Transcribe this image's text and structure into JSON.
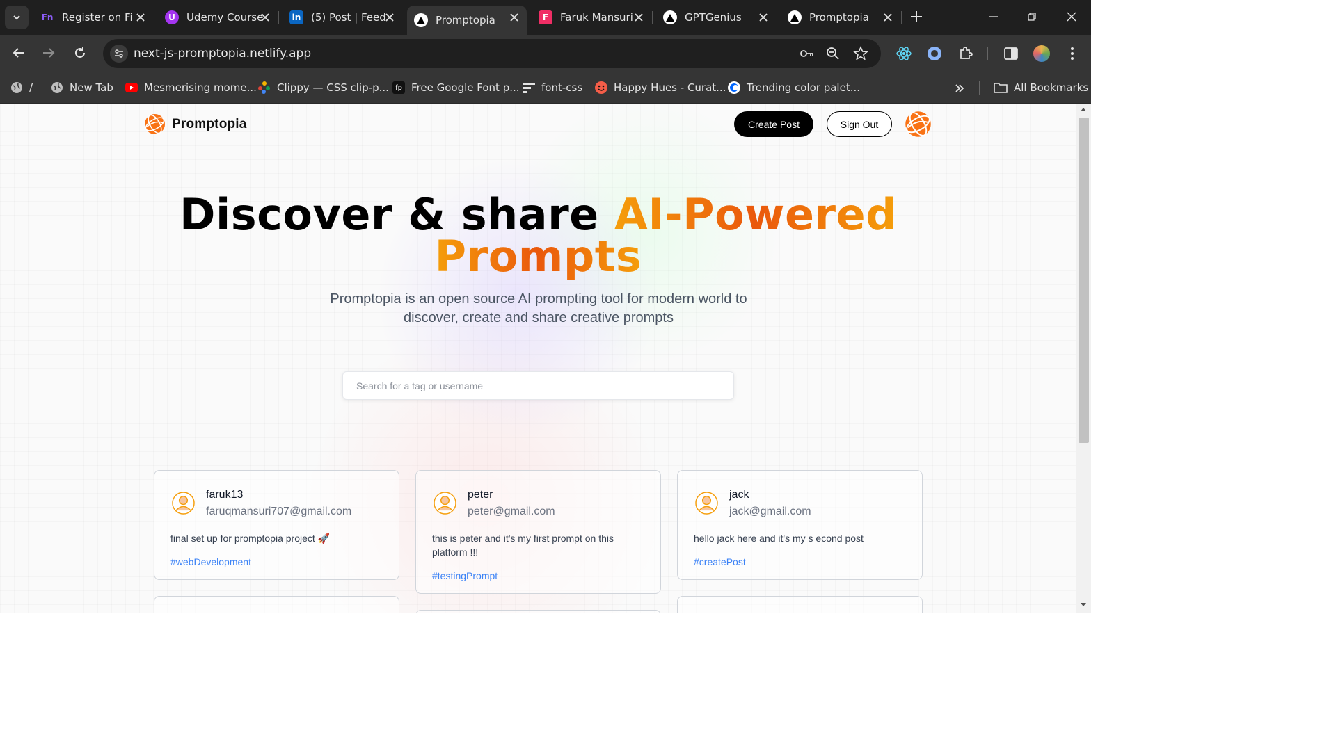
{
  "browser": {
    "tabs": [
      {
        "title": "Register on Fi",
        "favicon": "Fn",
        "color": "#7c3aed"
      },
      {
        "title": "Udemy Course",
        "favicon": "U",
        "color": "#a435f0"
      },
      {
        "title": "(5) Post | Feed",
        "favicon": "in",
        "color": "#0a66c2"
      },
      {
        "title": "Promptopia",
        "favicon": "triangle",
        "color": "#ffffff"
      },
      {
        "title": "Faruk Mansuri",
        "favicon": "F",
        "color": "#f02e65"
      },
      {
        "title": "GPTGenius",
        "favicon": "triangle",
        "color": "#ffffff"
      },
      {
        "title": "Promptopia",
        "favicon": "triangle",
        "color": "#ffffff"
      }
    ],
    "active_tab_index": 3,
    "url": "next-js-promptopia.netlify.app",
    "bookmarks": [
      {
        "label": "/",
        "icon": "globe-icon"
      },
      {
        "label": "New Tab",
        "icon": "globe-icon"
      },
      {
        "label": "Mesmerising mome...",
        "icon": "youtube-icon"
      },
      {
        "label": "Clippy — CSS clip-p...",
        "icon": "clippy-icon"
      },
      {
        "label": "Free Google Font p...",
        "icon": "fontpair-icon"
      },
      {
        "label": "font-css",
        "icon": "lines-icon"
      },
      {
        "label": "Happy Hues - Curat...",
        "icon": "happyhues-icon"
      },
      {
        "label": "Trending color palet...",
        "icon": "coolors-icon"
      }
    ],
    "all_bookmarks_label": "All Bookmarks"
  },
  "nav": {
    "logo_text": "Promptopia",
    "create_post_label": "Create Post",
    "sign_out_label": "Sign Out"
  },
  "hero": {
    "title_part1": "Discover & share",
    "title_part2": "AI-Powered",
    "title_part3": "Prompts",
    "subtitle": "Promptopia is an open source AI prompting tool for modern world to discover, create and share creative prompts"
  },
  "search": {
    "placeholder": "Search for a tag or username",
    "value": ""
  },
  "posts": [
    {
      "username": "faruk13",
      "email": "faruqmansuri707@gmail.com",
      "prompt": "final set up for promptopia project 🚀",
      "tag": "#webDevelopment"
    },
    {
      "username": "peter",
      "email": "peter@gmail.com",
      "prompt": "this is peter and it's my first prompt on this platform !!!",
      "tag": "#testingPrompt"
    },
    {
      "username": "jack",
      "email": "jack@gmail.com",
      "prompt": "hello jack here and it's my s econd post",
      "tag": "#createPost"
    }
  ],
  "colors": {
    "accent_orange": "#ea580c",
    "accent_amber": "#f59e0b",
    "tag_blue": "#3b82f6",
    "chrome_dark": "#1f1f1f",
    "chrome_mid": "#353535"
  }
}
